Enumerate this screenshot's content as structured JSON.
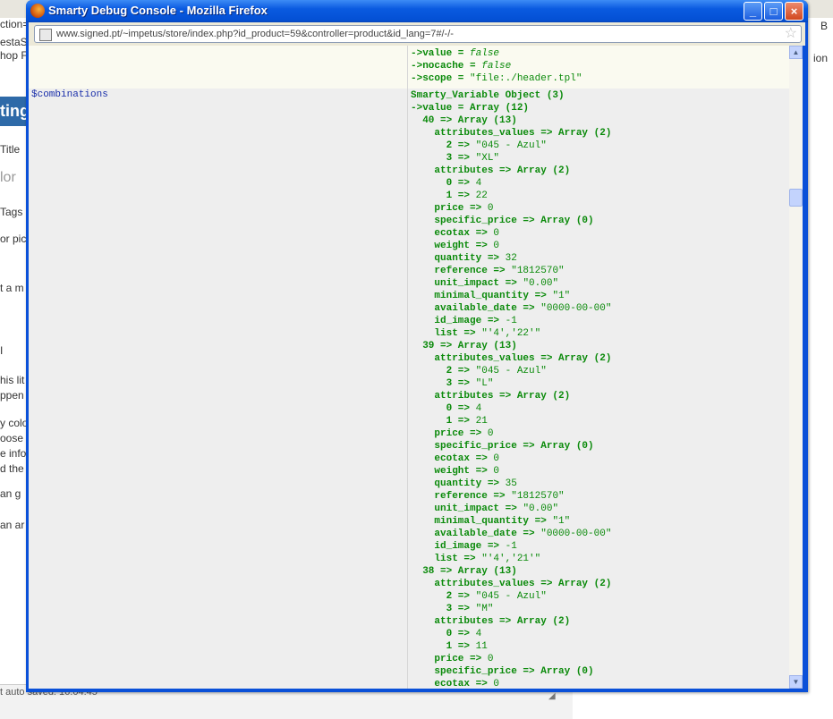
{
  "window": {
    "title": "Smarty Debug Console - Mozilla Firefox",
    "url": "www.signed.pt/~impetus/store/index.php?id_product=59&controller=product&id_lang=7#/-/-",
    "controls": [
      "_",
      "□",
      "×"
    ]
  },
  "background": {
    "left_fragments": [
      "ction=",
      "estaS",
      "hop F",
      "ting",
      "Title",
      "lor",
      "Tags",
      "or pick",
      "t a m",
      "I",
      "his lit",
      "ppen",
      "y colo",
      "oose",
      "e info",
      "d the",
      "an g",
      "an ar"
    ],
    "status_text": "t auto saved: 16:04:45",
    "right_fragments": [
      "B",
      "ion"
    ]
  },
  "debug": {
    "var_name": "$combinations",
    "prev_lines": [
      {
        "k": "->value",
        "eq": " = ",
        "v": "false",
        "italic": true
      },
      {
        "k": "->nocache",
        "eq": " = ",
        "v": "false",
        "italic": true
      },
      {
        "k": "->scope",
        "eq": " = ",
        "v": "\"file:./header.tpl\"",
        "italic": false
      }
    ],
    "lines": [
      {
        "indent": "",
        "k": "Smarty_Variable Object (3)",
        "v": ""
      },
      {
        "indent": "",
        "k": "->value = Array (12)",
        "v": ""
      },
      {
        "indent": "  ",
        "k": "40 => Array (13)",
        "v": ""
      },
      {
        "indent": "    ",
        "k": "attributes_values => Array (2)",
        "v": ""
      },
      {
        "indent": "      ",
        "k": "2 => ",
        "v": "\"045 - Azul\""
      },
      {
        "indent": "      ",
        "k": "3 => ",
        "v": "\"XL\""
      },
      {
        "indent": "    ",
        "k": "attributes => Array (2)",
        "v": ""
      },
      {
        "indent": "      ",
        "k": "0 => ",
        "v": "4"
      },
      {
        "indent": "      ",
        "k": "1 => ",
        "v": "22"
      },
      {
        "indent": "    ",
        "k": "price => ",
        "v": "0"
      },
      {
        "indent": "    ",
        "k": "specific_price => Array (0)",
        "v": ""
      },
      {
        "indent": "    ",
        "k": "ecotax => ",
        "v": "0"
      },
      {
        "indent": "    ",
        "k": "weight => ",
        "v": "0"
      },
      {
        "indent": "    ",
        "k": "quantity => ",
        "v": "32"
      },
      {
        "indent": "    ",
        "k": "reference => ",
        "v": "\"1812570\""
      },
      {
        "indent": "    ",
        "k": "unit_impact => ",
        "v": "\"0.00\""
      },
      {
        "indent": "    ",
        "k": "minimal_quantity => ",
        "v": "\"1\""
      },
      {
        "indent": "    ",
        "k": "available_date => ",
        "v": "\"0000-00-00\""
      },
      {
        "indent": "    ",
        "k": "id_image => ",
        "v": "-1"
      },
      {
        "indent": "    ",
        "k": "list => ",
        "v": "\"'4','22'\""
      },
      {
        "indent": "  ",
        "k": "39 => Array (13)",
        "v": ""
      },
      {
        "indent": "    ",
        "k": "attributes_values => Array (2)",
        "v": ""
      },
      {
        "indent": "      ",
        "k": "2 => ",
        "v": "\"045 - Azul\""
      },
      {
        "indent": "      ",
        "k": "3 => ",
        "v": "\"L\""
      },
      {
        "indent": "    ",
        "k": "attributes => Array (2)",
        "v": ""
      },
      {
        "indent": "      ",
        "k": "0 => ",
        "v": "4"
      },
      {
        "indent": "      ",
        "k": "1 => ",
        "v": "21"
      },
      {
        "indent": "    ",
        "k": "price => ",
        "v": "0"
      },
      {
        "indent": "    ",
        "k": "specific_price => Array (0)",
        "v": ""
      },
      {
        "indent": "    ",
        "k": "ecotax => ",
        "v": "0"
      },
      {
        "indent": "    ",
        "k": "weight => ",
        "v": "0"
      },
      {
        "indent": "    ",
        "k": "quantity => ",
        "v": "35"
      },
      {
        "indent": "    ",
        "k": "reference => ",
        "v": "\"1812570\""
      },
      {
        "indent": "    ",
        "k": "unit_impact => ",
        "v": "\"0.00\""
      },
      {
        "indent": "    ",
        "k": "minimal_quantity => ",
        "v": "\"1\""
      },
      {
        "indent": "    ",
        "k": "available_date => ",
        "v": "\"0000-00-00\""
      },
      {
        "indent": "    ",
        "k": "id_image => ",
        "v": "-1"
      },
      {
        "indent": "    ",
        "k": "list => ",
        "v": "\"'4','21'\""
      },
      {
        "indent": "  ",
        "k": "38 => Array (13)",
        "v": ""
      },
      {
        "indent": "    ",
        "k": "attributes_values => Array (2)",
        "v": ""
      },
      {
        "indent": "      ",
        "k": "2 => ",
        "v": "\"045 - Azul\""
      },
      {
        "indent": "      ",
        "k": "3 => ",
        "v": "\"M\""
      },
      {
        "indent": "    ",
        "k": "attributes => Array (2)",
        "v": ""
      },
      {
        "indent": "      ",
        "k": "0 => ",
        "v": "4"
      },
      {
        "indent": "      ",
        "k": "1 => ",
        "v": "11"
      },
      {
        "indent": "    ",
        "k": "price => ",
        "v": "0"
      },
      {
        "indent": "    ",
        "k": "specific_price => Array (0)",
        "v": ""
      },
      {
        "indent": "    ",
        "k": "ecotax => ",
        "v": "0"
      }
    ]
  },
  "colors": {
    "titlebar": "#0a5ae0",
    "code_green": "#0a8a0a",
    "varname_blue": "#1a2faa"
  }
}
